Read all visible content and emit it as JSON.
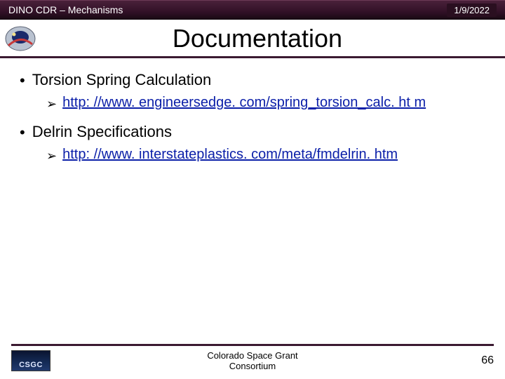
{
  "header": {
    "title": "DINO CDR – Mechanisms",
    "date": "1/9/2022"
  },
  "slide_title": "Documentation",
  "bullets": [
    {
      "text": "Torsion Spring Calculation",
      "link": "http: //www. engineersedge. com/spring_torsion_calc. ht m"
    },
    {
      "text": "Delrin Specifications",
      "link": "http: //www. interstateplastics. com/meta/fmdelrin. htm"
    }
  ],
  "footer": {
    "org_line1": "Colorado Space Grant",
    "org_line2": "Consortium",
    "logo_text": "CSGC",
    "page": "66"
  }
}
